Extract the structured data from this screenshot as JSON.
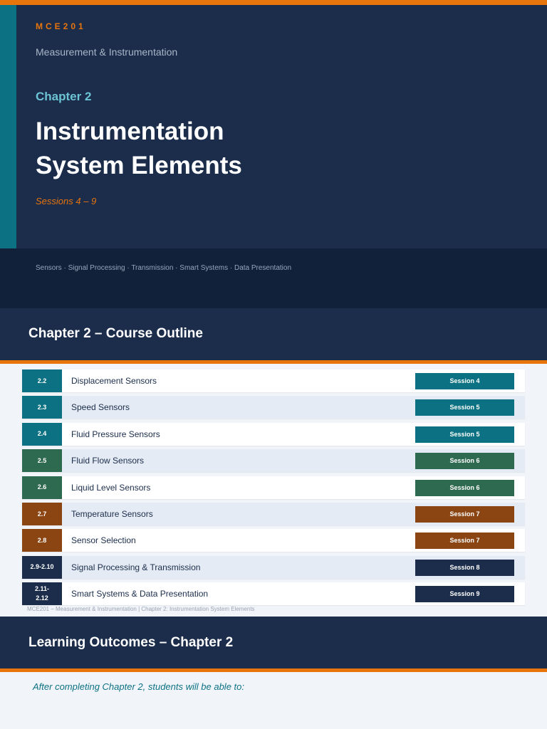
{
  "title_slide": {
    "course_code": "MCE201",
    "course_name": "Measurement & Instrumentation",
    "chapter": "Chapter 2",
    "title_line1": "Instrumentation",
    "title_line2": "System Elements",
    "sessions": "Sessions 4 – 9",
    "topics": "Sensors · Signal Processing · Transmission · Smart Systems · Data Presentation"
  },
  "outline": {
    "title": "Chapter 2 – Course Outline",
    "rows": [
      {
        "num": "2.2",
        "topic": "Displacement Sensors",
        "session": "Session 4",
        "color": "#0c7283"
      },
      {
        "num": "2.3",
        "topic": "Speed Sensors",
        "session": "Session 5",
        "color": "#0c7283"
      },
      {
        "num": "2.4",
        "topic": "Fluid Pressure Sensors",
        "session": "Session 5",
        "color": "#0c7283"
      },
      {
        "num": "2.5",
        "topic": "Fluid Flow Sensors",
        "session": "Session 6",
        "color": "#2e6a4f"
      },
      {
        "num": "2.6",
        "topic": "Liquid Level Sensors",
        "session": "Session 6",
        "color": "#2e6a4f"
      },
      {
        "num": "2.7",
        "topic": "Temperature Sensors",
        "session": "Session 7",
        "color": "#8b4513"
      },
      {
        "num": "2.8",
        "topic": "Sensor Selection",
        "session": "Session 7",
        "color": "#8b4513"
      },
      {
        "num": "2.9-2.10",
        "topic": "Signal Processing & Transmission",
        "session": "Session 8",
        "color": "#1b2d4b"
      },
      {
        "num": "2.11-\n2.12",
        "topic": "Smart Systems & Data Presentation",
        "session": "Session 9",
        "color": "#1b2d4b"
      }
    ],
    "footer": "MCE201 – Measurement & Instrumentation  |  Chapter 2: Instrumentation System Elements"
  },
  "learning_outcomes": {
    "title": "Learning Outcomes – Chapter 2",
    "intro": "After completing Chapter 2, students will be able to:"
  },
  "colors": {
    "navy": "#1b2d4b",
    "accent_orange": "#e8740c",
    "teal": "#0c7283",
    "green": "#2e6a4f",
    "brown": "#8b4513"
  }
}
